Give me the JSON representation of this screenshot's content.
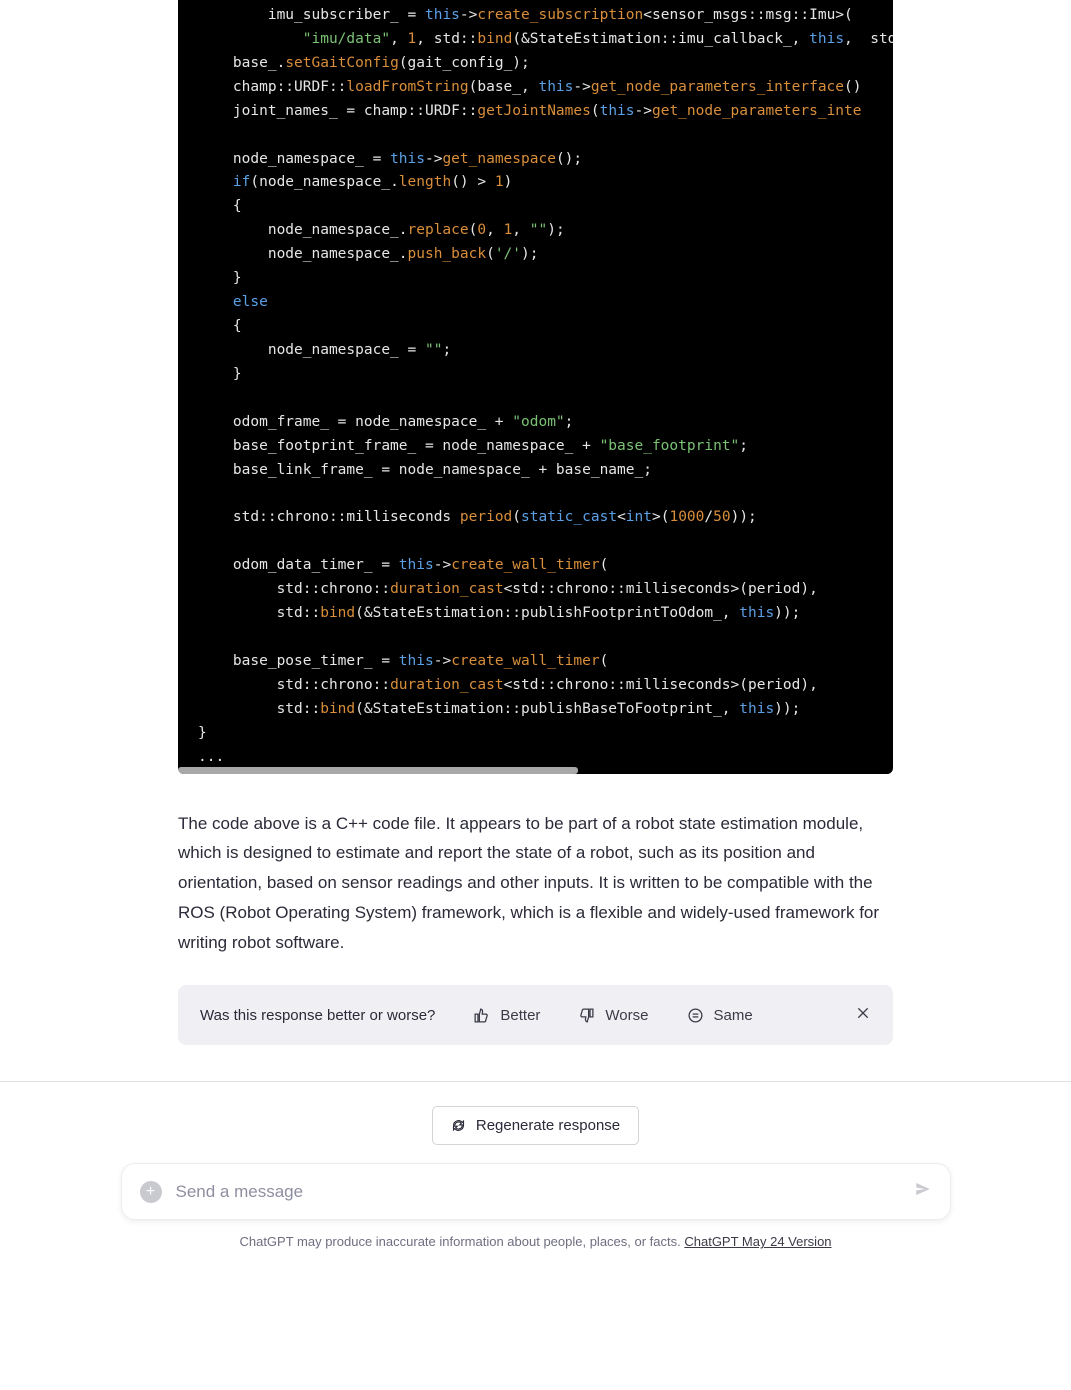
{
  "code": {
    "tokens": [
      [
        [
          "p",
          "        imu_subscriber_ = "
        ],
        [
          "k",
          "this"
        ],
        [
          "p",
          "->"
        ],
        [
          "f",
          "create_subscription"
        ],
        [
          "p",
          "<sensor_msgs::msg::Imu>("
        ]
      ],
      [
        [
          "p",
          "            "
        ],
        [
          "s",
          "\"imu/data\""
        ],
        [
          "p",
          ", "
        ],
        [
          "n",
          "1"
        ],
        [
          "p",
          ", std::"
        ],
        [
          "f",
          "bind"
        ],
        [
          "p",
          "(&StateEstimation::imu_callback_, "
        ],
        [
          "k",
          "this"
        ],
        [
          "p",
          ",  std"
        ]
      ],
      [
        [
          "p",
          "    base_."
        ],
        [
          "f",
          "setGaitConfig"
        ],
        [
          "p",
          "(gait_config_);"
        ]
      ],
      [
        [
          "p",
          "    champ::URDF::"
        ],
        [
          "f",
          "loadFromString"
        ],
        [
          "p",
          "(base_, "
        ],
        [
          "k",
          "this"
        ],
        [
          "p",
          "->"
        ],
        [
          "f",
          "get_node_parameters_interface"
        ],
        [
          "p",
          "()"
        ]
      ],
      [
        [
          "p",
          "    joint_names_ = champ::URDF::"
        ],
        [
          "f",
          "getJointNames"
        ],
        [
          "p",
          "("
        ],
        [
          "k",
          "this"
        ],
        [
          "p",
          "->"
        ],
        [
          "f",
          "get_node_parameters_inte"
        ]
      ],
      [
        [
          "p",
          ""
        ]
      ],
      [
        [
          "p",
          "    node_namespace_ = "
        ],
        [
          "k",
          "this"
        ],
        [
          "p",
          "->"
        ],
        [
          "f",
          "get_namespace"
        ],
        [
          "p",
          "();"
        ]
      ],
      [
        [
          "p",
          "    "
        ],
        [
          "k",
          "if"
        ],
        [
          "p",
          "(node_namespace_."
        ],
        [
          "f",
          "length"
        ],
        [
          "p",
          "() > "
        ],
        [
          "n",
          "1"
        ],
        [
          "p",
          ")"
        ]
      ],
      [
        [
          "p",
          "    {"
        ]
      ],
      [
        [
          "p",
          "        node_namespace_."
        ],
        [
          "f",
          "replace"
        ],
        [
          "p",
          "("
        ],
        [
          "n",
          "0"
        ],
        [
          "p",
          ", "
        ],
        [
          "n",
          "1"
        ],
        [
          "p",
          ", "
        ],
        [
          "s",
          "\"\""
        ],
        [
          "p",
          ");"
        ]
      ],
      [
        [
          "p",
          "        node_namespace_."
        ],
        [
          "f",
          "push_back"
        ],
        [
          "p",
          "("
        ],
        [
          "s",
          "'/'"
        ],
        [
          "p",
          ");"
        ]
      ],
      [
        [
          "p",
          "    }"
        ]
      ],
      [
        [
          "p",
          "    "
        ],
        [
          "k",
          "else"
        ]
      ],
      [
        [
          "p",
          "    {"
        ]
      ],
      [
        [
          "p",
          "        node_namespace_ = "
        ],
        [
          "s",
          "\"\""
        ],
        [
          "p",
          ";"
        ]
      ],
      [
        [
          "p",
          "    }"
        ]
      ],
      [
        [
          "p",
          ""
        ]
      ],
      [
        [
          "p",
          "    odom_frame_ = node_namespace_ + "
        ],
        [
          "s",
          "\"odom\""
        ],
        [
          "p",
          ";"
        ]
      ],
      [
        [
          "p",
          "    base_footprint_frame_ = node_namespace_ + "
        ],
        [
          "s",
          "\"base_footprint\""
        ],
        [
          "p",
          ";"
        ]
      ],
      [
        [
          "p",
          "    base_link_frame_ = node_namespace_ + base_name_;"
        ]
      ],
      [
        [
          "p",
          ""
        ]
      ],
      [
        [
          "p",
          "    std::chrono::milliseconds "
        ],
        [
          "f",
          "period"
        ],
        [
          "p",
          "("
        ],
        [
          "k",
          "static_cast"
        ],
        [
          "p",
          "<"
        ],
        [
          "k",
          "int"
        ],
        [
          "p",
          ">("
        ],
        [
          "n",
          "1000"
        ],
        [
          "p",
          "/"
        ],
        [
          "n",
          "50"
        ],
        [
          "p",
          "));"
        ]
      ],
      [
        [
          "p",
          ""
        ]
      ],
      [
        [
          "p",
          "    odom_data_timer_ = "
        ],
        [
          "k",
          "this"
        ],
        [
          "p",
          "->"
        ],
        [
          "f",
          "create_wall_timer"
        ],
        [
          "p",
          "("
        ]
      ],
      [
        [
          "p",
          "         std::chrono::"
        ],
        [
          "f",
          "duration_cast"
        ],
        [
          "p",
          "<std::chrono::milliseconds>(period),"
        ]
      ],
      [
        [
          "p",
          "         std::"
        ],
        [
          "f",
          "bind"
        ],
        [
          "p",
          "(&StateEstimation::publishFootprintToOdom_, "
        ],
        [
          "k",
          "this"
        ],
        [
          "p",
          "));"
        ]
      ],
      [
        [
          "p",
          ""
        ]
      ],
      [
        [
          "p",
          "    base_pose_timer_ = "
        ],
        [
          "k",
          "this"
        ],
        [
          "p",
          "->"
        ],
        [
          "f",
          "create_wall_timer"
        ],
        [
          "p",
          "("
        ]
      ],
      [
        [
          "p",
          "         std::chrono::"
        ],
        [
          "f",
          "duration_cast"
        ],
        [
          "p",
          "<std::chrono::milliseconds>(period),"
        ]
      ],
      [
        [
          "p",
          "         std::"
        ],
        [
          "f",
          "bind"
        ],
        [
          "p",
          "(&StateEstimation::publishBaseToFootprint_, "
        ],
        [
          "k",
          "this"
        ],
        [
          "p",
          "));"
        ]
      ],
      [
        [
          "p",
          "}"
        ]
      ],
      [
        [
          "p",
          "..."
        ]
      ]
    ]
  },
  "explanation": "The code above is a C++ code file. It appears to be part of a robot state estimation module, which is designed to estimate and report the state of a robot, such as its position and orientation, based on sensor readings and other inputs. It is written to be compatible with the ROS (Robot Operating System) framework, which is a flexible and widely-used framework for writing robot software.",
  "feedback": {
    "question": "Was this response better or worse?",
    "better": "Better",
    "worse": "Worse",
    "same": "Same"
  },
  "regenerate": "Regenerate response",
  "input": {
    "placeholder": "Send a message"
  },
  "footer": {
    "text": "ChatGPT may produce inaccurate information about people, places, or facts. ",
    "link": "ChatGPT May 24 Version"
  }
}
